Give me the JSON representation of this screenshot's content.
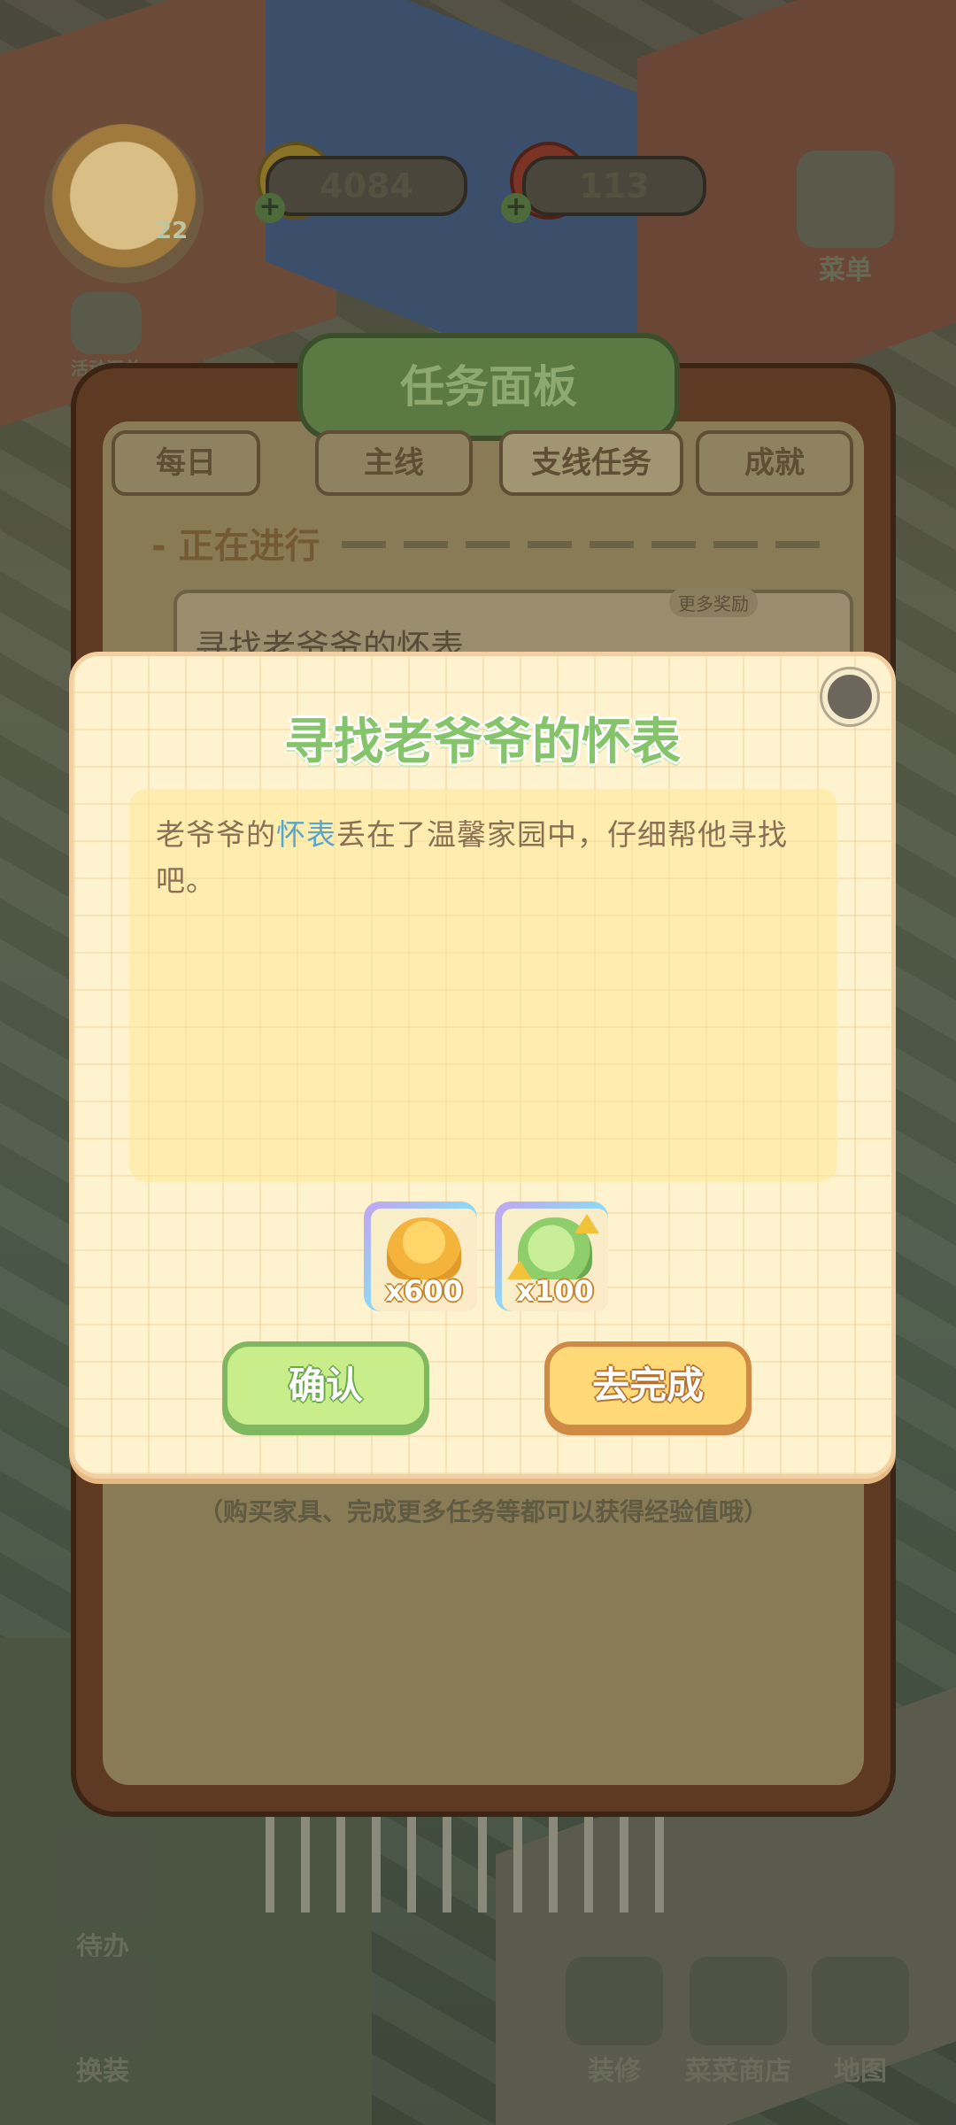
{
  "hud": {
    "level": "22",
    "coins": "4084",
    "tomatoes": "113",
    "menu_label": "菜单",
    "activity_label": "活动汇总"
  },
  "task_panel": {
    "title": "任务面板",
    "tabs": [
      {
        "label": "每日",
        "active": false
      },
      {
        "label": "主线",
        "active": false
      },
      {
        "label": "支线任务",
        "active": true
      },
      {
        "label": "成就",
        "active": false
      }
    ],
    "section": "- 正在进行",
    "task_title": "寻找老爷爷的怀表",
    "more_rewards": "更多奖励",
    "footer_hint": "（购买家具、完成更多任务等都可以获得经验值哦）"
  },
  "bottom_bar": {
    "todo": "待办",
    "dressup": "换装",
    "decorate": "装修",
    "shop": "菜菜商店",
    "map": "地图"
  },
  "dialog": {
    "title": "寻找老爷爷的怀表",
    "desc_before": "老爷爷的",
    "desc_highlight": "怀表",
    "desc_after": "丢在了温馨家园中，仔细帮他寻找吧。",
    "rewards": [
      {
        "icon": "gold-coins-icon",
        "count": "x600"
      },
      {
        "icon": "cabbage-exp-icon",
        "count": "x100"
      }
    ],
    "confirm_label": "确认",
    "goto_label": "去完成"
  },
  "colors": {
    "title_green": "#86c46c",
    "highlight_blue": "#58a6cc",
    "confirm_green": "#c8ee8b",
    "goto_yellow": "#ffd977"
  }
}
